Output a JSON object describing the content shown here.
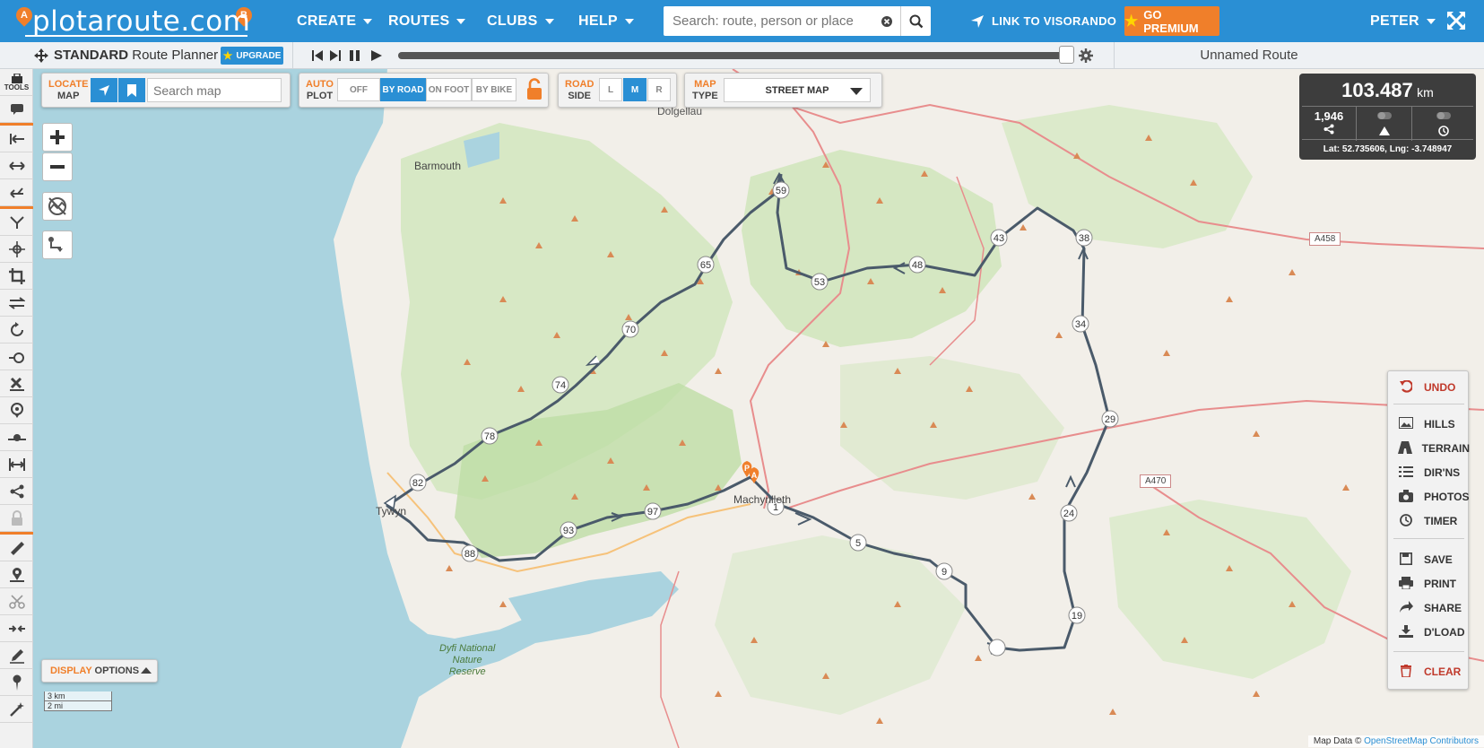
{
  "brand": {
    "logo_text": "plotaroute.com",
    "pin_a": "A",
    "pin_b": "B"
  },
  "nav": {
    "create": "CREATE",
    "routes": "ROUTES",
    "clubs": "CLUBS",
    "help": "HELP",
    "search_placeholder": "Search: route, person or place",
    "visorando": "LINK TO VISORANDO",
    "premium": "GO PREMIUM",
    "user": "PETER"
  },
  "subbar": {
    "planner_bold": "STANDARD",
    "planner_rest": "Route Planner",
    "upgrade": "UPGRADE",
    "route_name": "Unnamed Route",
    "progress_percent": 100
  },
  "sidebar": {
    "tools_label": "TOOLS"
  },
  "controls": {
    "locate_a": "LOCATE",
    "locate_b": "MAP",
    "search_map_placeholder": "Search map",
    "auto_a": "AUTO",
    "auto_b": "PLOT",
    "plot_modes": [
      "OFF",
      "BY ROAD",
      "ON FOOT",
      "BY BIKE"
    ],
    "plot_selected": "BY ROAD",
    "road_a": "ROAD",
    "road_b": "SIDE",
    "road_sides": [
      "L",
      "M",
      "R"
    ],
    "road_selected": "M",
    "map_a": "MAP",
    "map_b": "TYPE",
    "map_type": "STREET MAP",
    "display_a": "DISPLAY",
    "display_b": "OPTIONS"
  },
  "stats": {
    "distance": "103.487",
    "distance_unit": "km",
    "elevation": "1,946",
    "coords": "Lat: 52.735606, Lng: -3.748947"
  },
  "right_panel": {
    "undo": "UNDO",
    "hills": "HILLS",
    "terrain": "TERRAIN",
    "dirns": "DIR'NS",
    "photos": "PHOTOS",
    "timer": "TIMER",
    "save": "SAVE",
    "print": "PRINT",
    "share": "SHARE",
    "dload": "D'LOAD",
    "clear": "CLEAR"
  },
  "map_labels": {
    "dolgellau": "Dolgellau",
    "barmouth": "Barmouth",
    "machynlleth": "Machynlleth",
    "tywyn": "Tywyn",
    "dyfi": "Dyfi National",
    "nature": "Nature",
    "reserve": "Reserve",
    "a458": "A458",
    "a470": "A470"
  },
  "waypoints": [
    "59",
    "65",
    "70",
    "74",
    "78",
    "82",
    "88",
    "93",
    "97",
    "1",
    "5",
    "9",
    "19",
    "24",
    "29",
    "34",
    "38",
    "43",
    "48",
    "53"
  ],
  "scale": {
    "km": "3 km",
    "mi": "2 mi"
  },
  "attribution": {
    "text": "Map Data ©",
    "link": "OpenStreetMap Contributors"
  },
  "colors": {
    "topbar": "#2a8fd4",
    "accent": "#f07f2a",
    "route": "#4a5a6a",
    "sea": "#aad3df"
  }
}
